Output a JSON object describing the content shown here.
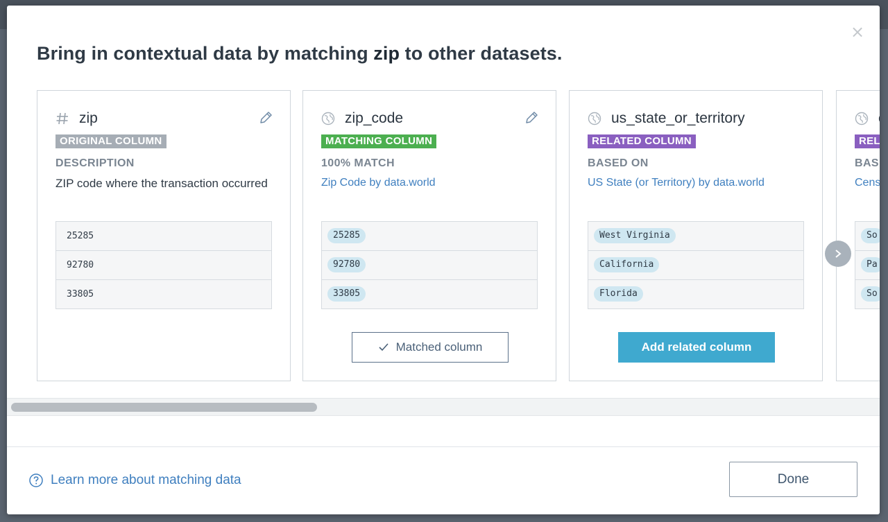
{
  "modal": {
    "title_prefix": "Bring in contextual data by matching ",
    "title_bold": "zip",
    "title_suffix": " to other datasets.",
    "close_glyph": "×"
  },
  "cards": [
    {
      "icon": "hash-icon",
      "name": "zip",
      "badge": "ORIGINAL COLUMN",
      "badge_color": "#a6adb5",
      "meta_label": "DESCRIPTION",
      "meta_value": "ZIP code where the transaction occurred",
      "samples": [
        "25285",
        "92780",
        "33805"
      ]
    },
    {
      "icon": "globe-icon",
      "name": "zip_code",
      "badge": "MATCHING COLUMN",
      "badge_color": "#4caf50",
      "meta_label": "100% MATCH",
      "meta_value": "Zip Code by data.world",
      "samples": [
        "25285",
        "92780",
        "33805"
      ],
      "button_label": "Matched column",
      "button_icon": "checkmark-icon"
    },
    {
      "icon": "globe-icon",
      "name": "us_state_or_territory",
      "badge": "RELATED COLUMN",
      "badge_color": "#8a5fc0",
      "meta_label": "BASED ON",
      "meta_value": "US State (or Territory) by data.world",
      "samples": [
        "West Virginia",
        "California",
        "Florida"
      ],
      "button_label": "Add related column"
    },
    {
      "icon": "globe-icon",
      "name": "c",
      "badge": "REL",
      "badge_color": "#8a5fc0",
      "meta_label": "BAS",
      "meta_value": "Cens",
      "samples": [
        "So",
        "Pa",
        "So"
      ]
    }
  ],
  "footer": {
    "help_link": "Learn more about matching data",
    "done_label": "Done"
  },
  "colors": {
    "accent": "#3fa9cf",
    "link": "#3f7fbf",
    "original_badge": "#a6adb5",
    "matching_badge": "#4caf50",
    "related_badge": "#8a5fc0"
  }
}
